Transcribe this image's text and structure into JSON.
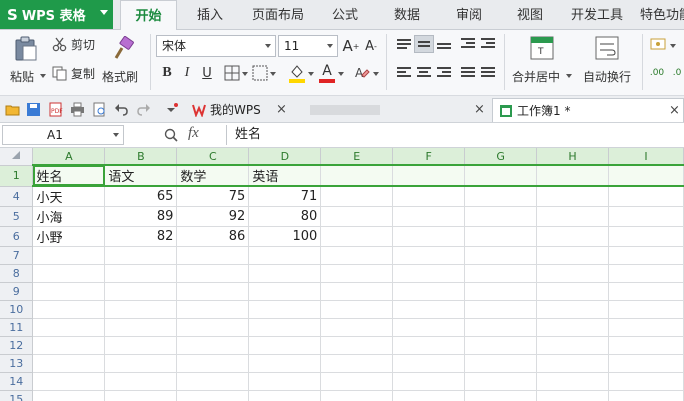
{
  "app": {
    "name": "WPS 表格",
    "logo": "S"
  },
  "menu_tabs": [
    "开始",
    "插入",
    "页面布局",
    "公式",
    "数据",
    "审阅",
    "视图",
    "开发工具",
    "特色功能"
  ],
  "ribbon": {
    "paste": "粘贴",
    "cut": "剪切",
    "copy": "复制",
    "format_painter": "格式刷",
    "font_name": "宋体",
    "font_size": "11",
    "merge_center": "合并居中",
    "wrap_text": "自动换行",
    "colors": {
      "font_color": "#e02424",
      "fill_color": "#ffd700"
    }
  },
  "quick_access": {
    "tab_my_wps": "我的WPS",
    "tab_workbook": "工作簿1 *"
  },
  "formula_bar": {
    "cell_ref": "A1",
    "fx": "fx",
    "content": "姓名"
  },
  "sheet": {
    "columns": [
      "A",
      "B",
      "C",
      "D",
      "E",
      "F",
      "G",
      "H",
      "I"
    ],
    "rows": [
      {
        "num": "1",
        "cells": [
          "姓名",
          "语文",
          "数学",
          "英语"
        ]
      },
      {
        "num": "4",
        "cells": [
          "小天",
          "65",
          "75",
          "71"
        ]
      },
      {
        "num": "5",
        "cells": [
          "小海",
          "89",
          "92",
          "80"
        ]
      },
      {
        "num": "6",
        "cells": [
          "小野",
          "82",
          "86",
          "100"
        ]
      },
      {
        "num": "7",
        "cells": []
      },
      {
        "num": "8",
        "cells": []
      },
      {
        "num": "9",
        "cells": []
      },
      {
        "num": "10",
        "cells": []
      },
      {
        "num": "11",
        "cells": []
      },
      {
        "num": "12",
        "cells": []
      },
      {
        "num": "13",
        "cells": []
      },
      {
        "num": "14",
        "cells": []
      },
      {
        "num": "15",
        "cells": []
      }
    ]
  }
}
